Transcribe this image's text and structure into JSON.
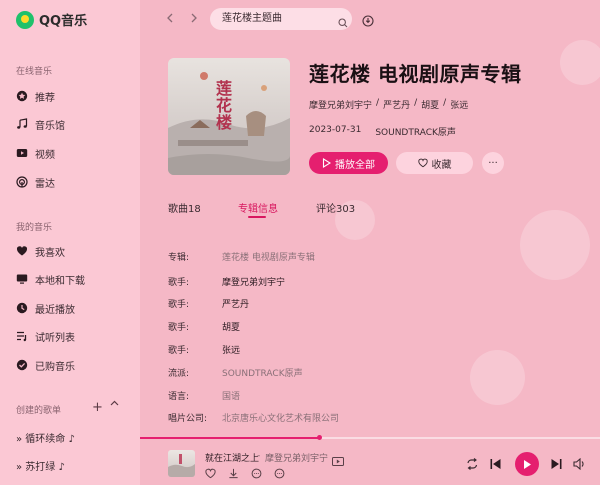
{
  "app": {
    "name": "QQ音乐"
  },
  "sidebar": {
    "online_title": "在线音乐",
    "online_items": [
      {
        "label": "推荐",
        "icon": "star-circle-icon"
      },
      {
        "label": "音乐馆",
        "icon": "music-note-icon"
      },
      {
        "label": "视频",
        "icon": "video-icon"
      },
      {
        "label": "雷达",
        "icon": "radar-icon"
      }
    ],
    "my_title": "我的音乐",
    "my_items": [
      {
        "label": "我喜欢",
        "icon": "heart-icon"
      },
      {
        "label": "本地和下载",
        "icon": "computer-icon"
      },
      {
        "label": "最近播放",
        "icon": "clock-icon"
      },
      {
        "label": "试听列表",
        "icon": "playlist-icon"
      },
      {
        "label": "已购音乐",
        "icon": "check-circle-icon"
      }
    ],
    "playlists_title": "创建的歌单",
    "playlists": [
      {
        "label": "» 循环续命 ♪"
      },
      {
        "label": "» 苏打绿 ♪"
      }
    ]
  },
  "search": {
    "value": "莲花楼主题曲"
  },
  "album": {
    "title": "莲花楼 电视剧原声专辑",
    "artists": [
      "摩登兄弟刘宇宁",
      "严艺丹",
      "胡夏",
      "张远"
    ],
    "separator": "/",
    "date": "2023-07-31",
    "genre": "SOUNDTRACK原声",
    "cover_text": "莲花楼"
  },
  "actions": {
    "play_all": "播放全部",
    "collect": "收藏",
    "more": "···"
  },
  "tabs": [
    {
      "label": "歌曲18",
      "active": false
    },
    {
      "label": "专辑信息",
      "active": true
    },
    {
      "label": "评论303",
      "active": false
    }
  ],
  "info": [
    {
      "label": "专辑:",
      "value": "莲花楼 电视剧原声专辑",
      "style": "grey"
    },
    {
      "label": "歌手:",
      "value": "摩登兄弟刘宇宁",
      "style": "link"
    },
    {
      "label": "歌手:",
      "value": "严艺丹",
      "style": "link"
    },
    {
      "label": "歌手:",
      "value": "胡夏",
      "style": "link"
    },
    {
      "label": "歌手:",
      "value": "张远",
      "style": "link"
    },
    {
      "label": "流派:",
      "value": "SOUNDTRACK原声",
      "style": "grey"
    },
    {
      "label": "语言:",
      "value": "国语",
      "style": "grey"
    },
    {
      "label": "唱片公司:",
      "value": "北京唐乐心文化艺术有限公司",
      "style": "grey"
    }
  ],
  "player": {
    "song": "就在江湖之上",
    "separator": "-",
    "artist": "摩登兄弟刘宇宁",
    "progress": 0.39
  },
  "colors": {
    "accent": "#e51f6f",
    "background": "#f5b8c6",
    "sidebar": "#ffd6e0"
  }
}
